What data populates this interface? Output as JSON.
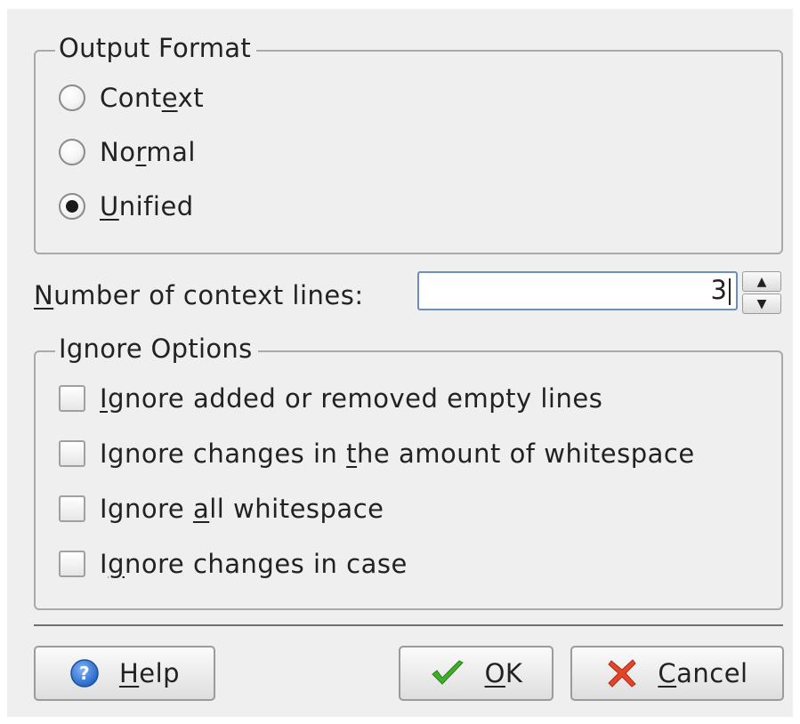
{
  "output_format": {
    "title": "Output Format",
    "options": [
      {
        "pre": "Cont",
        "u": "e",
        "post": "xt",
        "checked": false
      },
      {
        "pre": "No",
        "u": "r",
        "post": "mal",
        "checked": false
      },
      {
        "pre": "",
        "u": "U",
        "post": "nified",
        "checked": true
      }
    ]
  },
  "context_lines": {
    "label_u": "N",
    "label_rest": "umber of context lines:",
    "value": "3"
  },
  "ignore_options": {
    "title": "Ignore Options",
    "options": [
      {
        "pre": "",
        "u": "I",
        "post": "gnore added or removed empty lines",
        "checked": false
      },
      {
        "pre": "Ignore changes in ",
        "u": "t",
        "post": "he amount of whitespace",
        "checked": false
      },
      {
        "pre": "Ignore ",
        "u": "a",
        "post": "ll whitespace",
        "checked": false
      },
      {
        "pre": "I",
        "u": "g",
        "post": "nore changes in case",
        "checked": false
      }
    ]
  },
  "buttons": {
    "help": {
      "u": "H",
      "rest": "elp",
      "icon": "help-icon"
    },
    "ok": {
      "u": "O",
      "rest": "K",
      "icon": "check-icon"
    },
    "cancel": {
      "u": "C",
      "rest": "ancel",
      "icon": "cancel-icon"
    }
  },
  "colors": {
    "help_icon": "#2f7be0",
    "ok_icon": "#3fae2a",
    "cancel_icon": "#e2452a",
    "focus_border": "#6a8fbf"
  }
}
